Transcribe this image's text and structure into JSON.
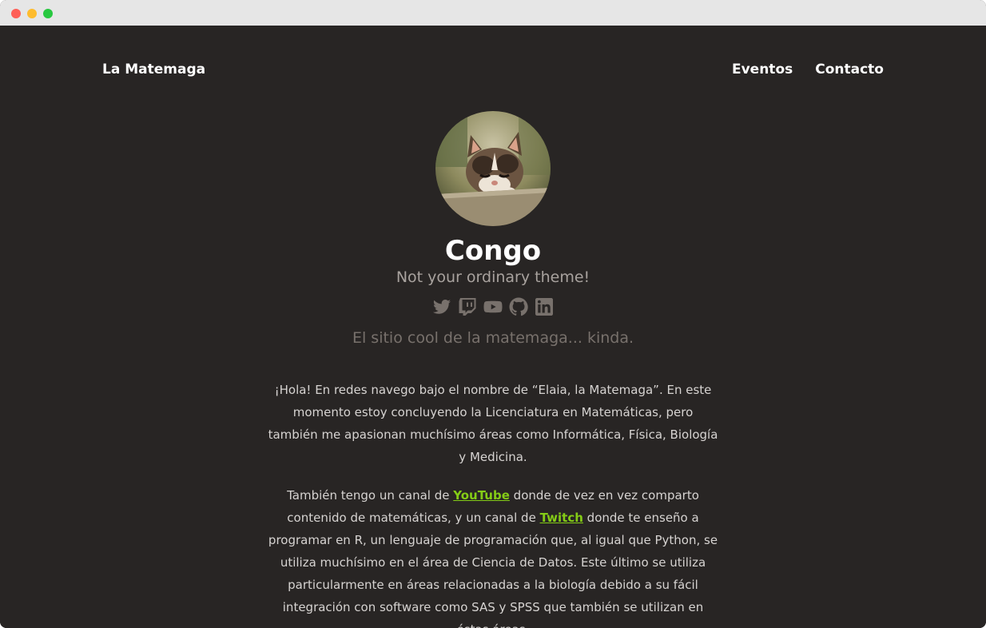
{
  "header": {
    "site_title": "La Matemaga",
    "nav": [
      {
        "label": "Eventos"
      },
      {
        "label": "Contacto"
      }
    ]
  },
  "author": {
    "name": "Congo",
    "headline": "Not your ordinary theme!",
    "socials": [
      {
        "icon": "twitter-icon"
      },
      {
        "icon": "twitch-icon"
      },
      {
        "icon": "youtube-icon"
      },
      {
        "icon": "github-icon"
      },
      {
        "icon": "linkedin-icon"
      }
    ]
  },
  "site": {
    "description": "El sitio cool de la matemaga... kinda."
  },
  "content": {
    "p1": "¡Hola! En redes navego bajo el nombre de “Elaia, la Matemaga”. En este momento estoy concluyendo la Licenciatura en Matemáticas, pero también me apasionan muchísimo áreas como Informática, Física, Biología y Medicina.",
    "p2_a": "También tengo un canal de ",
    "p2_link1": "YouTube",
    "p2_b": " donde de vez en vez comparto contenido de matemáticas, y un canal de ",
    "p2_link2": "Twitch",
    "p2_c": " donde te enseño a programar en R, un lenguaje de programación que, al igual que Python, se utiliza muchísimo en el área de Ciencia de Datos. Este último se utiliza particularmente en áreas relacionadas a la biología debido a su fácil integración con software como SAS y SPSS que también se utilizan en éstas áreas."
  },
  "colors": {
    "background": "#282524",
    "accent_link": "#84cc16",
    "muted_text": "#a8a29e",
    "icon": "#78716c"
  }
}
